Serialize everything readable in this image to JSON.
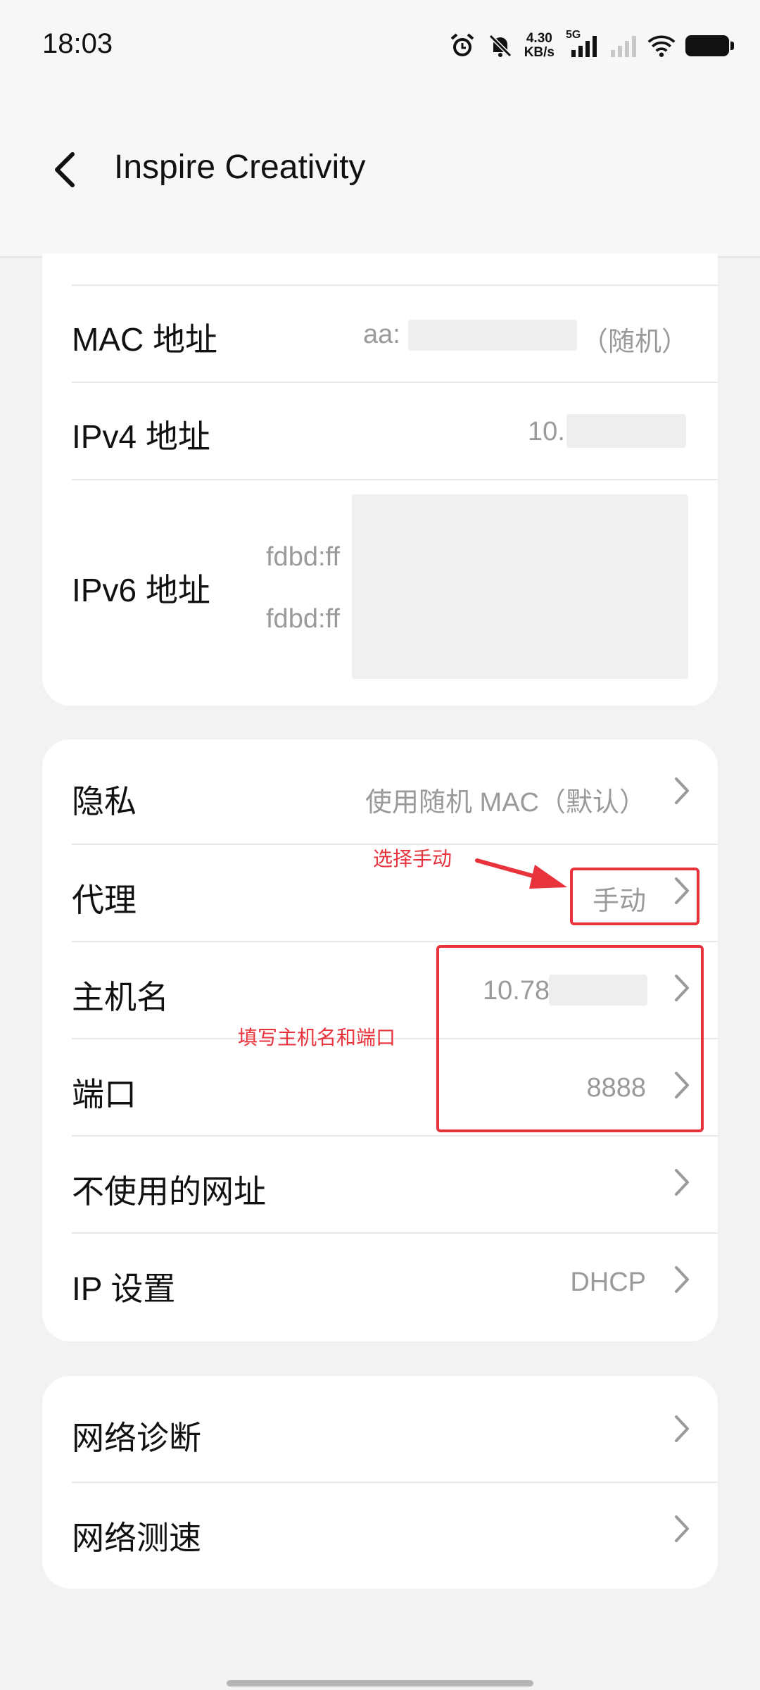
{
  "status_bar": {
    "time": "18:03",
    "net_speed_value": "4.30",
    "net_speed_unit": "KB/s",
    "network_type": "5G",
    "icons": [
      "alarm-icon",
      "mute-bell-icon",
      "signal-5g-icon",
      "signal-weak-icon",
      "wifi-icon",
      "battery-icon"
    ]
  },
  "header": {
    "title": "Inspire Creativity",
    "back_icon": "chevron-left-icon"
  },
  "network_info": {
    "mac_label": "MAC 地址",
    "mac_value": "aa:",
    "mac_suffix": "（随机）",
    "ipv4_label": "IPv4 地址",
    "ipv4_value": "10.",
    "ipv6_label": "IPv6 地址",
    "ipv6_value_1": "fdbd:ff",
    "ipv6_value_2": "fdbd:ff"
  },
  "settings": {
    "privacy_label": "隐私",
    "privacy_value": "使用随机 MAC（默认）",
    "proxy_label": "代理",
    "proxy_value": "手动",
    "hostname_label": "主机名",
    "hostname_value": "10.78",
    "port_label": "端口",
    "port_value": "8888",
    "bypass_label": "不使用的网址",
    "ip_settings_label": "IP 设置",
    "ip_settings_value": "DHCP"
  },
  "tools": {
    "diagnosis_label": "网络诊断",
    "speed_test_label": "网络测速"
  },
  "annotations": {
    "select_manual": "选择手动",
    "fill_host_port": "填写主机名和端口",
    "color": "#e8323c"
  }
}
